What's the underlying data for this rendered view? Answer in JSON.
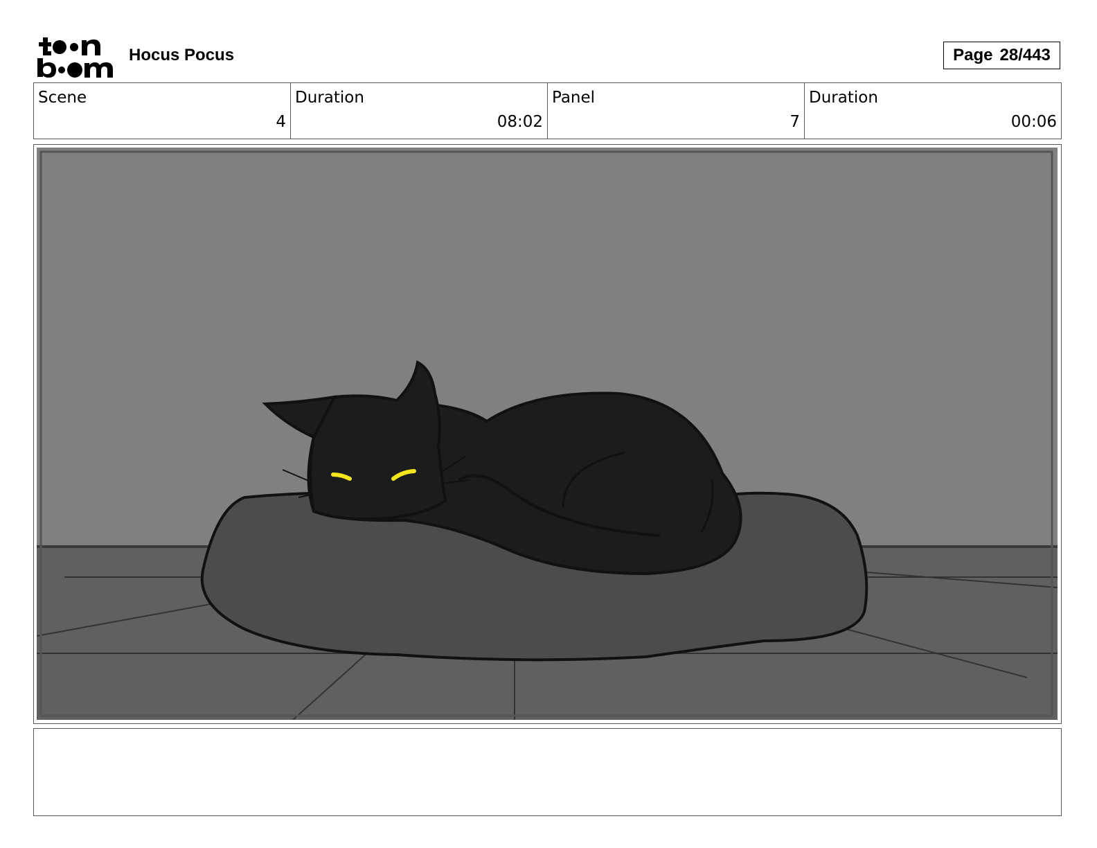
{
  "header": {
    "logo_text": "toon boom",
    "project_title": "Hocus Pocus",
    "page_label": "Page",
    "page_number": "28/443"
  },
  "info": [
    {
      "label": "Scene",
      "value": "4"
    },
    {
      "label": "Duration",
      "value": "08:02"
    },
    {
      "label": "Panel",
      "value": "7"
    },
    {
      "label": "Duration",
      "value": "00:06"
    }
  ],
  "panel": {
    "colors": {
      "wall": "#808080",
      "floor": "#5f5f5f",
      "cushion": "#4c4c4c",
      "cat": "#1c1c1c",
      "eyes": "#f5e61c",
      "outline": "#111111"
    }
  },
  "notes": {
    "text": ""
  }
}
